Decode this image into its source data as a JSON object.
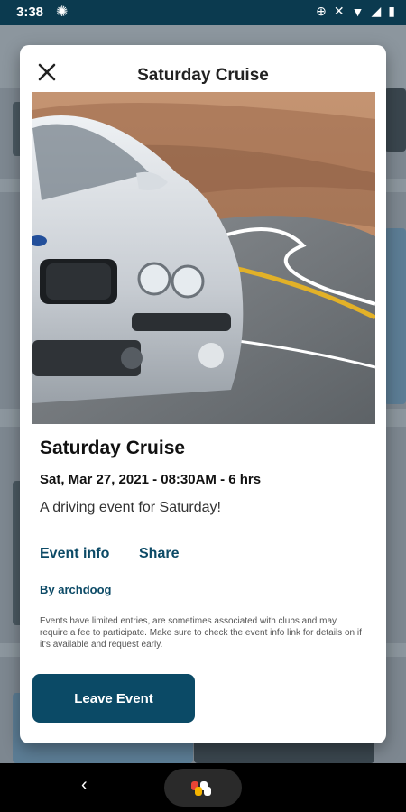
{
  "status": {
    "time": "3:38"
  },
  "modal": {
    "title": "Saturday Cruise",
    "event_title": "Saturday Cruise",
    "date_line": "Sat, Mar 27, 2021 - 08:30AM - 6 hrs",
    "description": "A driving event for Saturday!",
    "event_info_label": "Event info",
    "share_label": "Share",
    "author": "By archdoog",
    "note": "Events have limited entries, are sometimes associated with clubs and may require a fee to participate. Make sure to check the event info link for details on if it's available and request early.",
    "leave_label": "Leave Event"
  },
  "icons": {
    "close": "close-icon",
    "gear": "gear-icon",
    "back": "back-icon",
    "home": "home-icon"
  }
}
